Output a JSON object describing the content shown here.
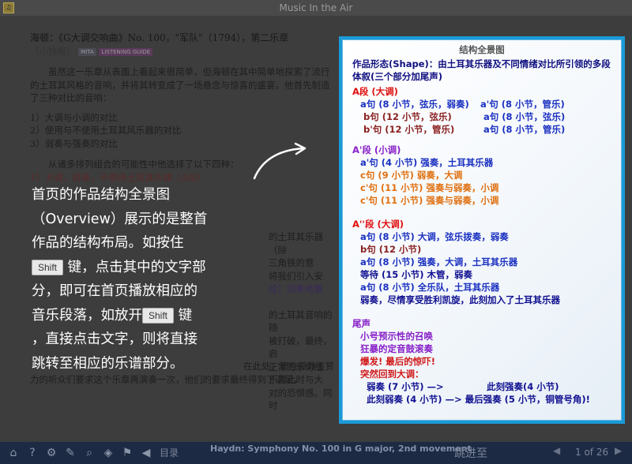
{
  "window": {
    "title": "Music In the Air"
  },
  "doc": {
    "title": "海顿：《G大调交响曲》No. 100，\"军队\"（1794），第二乐章",
    "subtitle": "（小快板）",
    "tag_mita": "MITA",
    "tag_listening": "LISTENING GUIDE",
    "para1": "虽然这一乐章从表面上看起来很简单，但海顿在其中简单地探索了流行的土耳其风格的音响，并将其转变成了一场悬念与惊喜的盛宴。他首先制造了三种对比的音响：",
    "list": [
      "1）大调与小调的对比",
      "2）使用与不使用土耳其风乐器的对比",
      "3）弱奏与强奏的对比"
    ],
    "para2": "从诸多排列组合的可能性中他选择了以下四种：",
    "line_a1": "1）大调，弱奏，不使用土耳其乐器（A段）",
    "fragment1": "的土耳其乐器（除",
    "fragment2": "三角铁的意",
    "fragment3": "将我们引入安",
    "fragment4": "段）完美地蓄",
    "fragment5": "的土耳其音响的随",
    "fragment6": "被打破，最终，启",
    "fragment7": "正常的乐句结",
    "fragment8": "乐器此时与大",
    "fragment9": "对的恐惧感。同时",
    "fragment10": "在此处，那些颇具鉴赏",
    "para_end": "力的听众们要求这个乐章再演奏一次，他们的要求最终得到了满足。"
  },
  "overlay": {
    "line1": "首页的作品结构全景图",
    "line2": "（Overview）展示的是整首",
    "line3": "作品的结构布局。如按住",
    "key_label": "Shift",
    "line4_after": "键，点击其中的文字部",
    "line5": "分，即可在首页播放相应的",
    "line6_before": "音乐段落，如放开",
    "line6_after": "键",
    "line7": "，直接点击文字，则将直接",
    "line8": "跳转至相应的乐谱部分。"
  },
  "panel": {
    "title": "结构全景图",
    "shape": "作品形态(Shape)：由土耳其乐器及不同情绪对比所引领的多段体叙(三个部分加尾声)",
    "secA": "A段 (大调)",
    "a_rows": [
      [
        "a句 (8 小节，弦乐，弱奏)",
        "a'句 (8 小节，管乐)"
      ],
      [
        "b句 (12 小节，弦乐)",
        "a句 (8 小节，弦乐)"
      ],
      [
        "b'句 (12 小节，管乐)",
        "a句 (8 小节，管乐)"
      ]
    ],
    "secA1": "A'段 (小调)",
    "a1_rows": [
      "a'句 (4 小节) 强奏，土耳其乐器",
      "c句 (9 小节) 弱奏，大调",
      "c'句 (11 小节) 强奏与弱奏，小调",
      "c'句 (11 小节) 强奏与弱奏，小调"
    ],
    "secA2": "A''段 (大调)",
    "a2_rows": [
      "a句 (8 小节) 大调，弦乐拨奏，弱奏",
      "b句 (12 小节)",
      "a句 (8 小节) 强奏，大调，土耳其乐器",
      "等待 (15 小节) 木管，弱奏",
      "a句 (8 小节) 全乐队，土耳其乐器",
      "弱奏，尽情享受胜利凯旋，此刻加入了土耳其乐器"
    ],
    "coda": "尾声",
    "coda_rows": [
      "小号预示性的召唤",
      "狂暴的定音鼓滚奏",
      "爆发! 最后的惊吓!"
    ],
    "coda_return": "突然回到大调：",
    "coda_end": [
      [
        "弱奏 (7 小节) —>",
        "此刻强奏(4 小节)"
      ],
      [
        "此刻弱奏 (4 小节) —> 最后强奏 (5 小节，铜管号角)!",
        ""
      ]
    ]
  },
  "bottom": {
    "home": "目录",
    "caption": "Haydn: Symphony No. 100 in G major, 2nd movement",
    "jump": "跳进至",
    "page": "1 of 26",
    "icons": [
      "home-icon",
      "help-icon",
      "gear-icon",
      "pencil-icon",
      "search-icon",
      "tag-icon",
      "flag-icon",
      "sound-icon"
    ]
  }
}
